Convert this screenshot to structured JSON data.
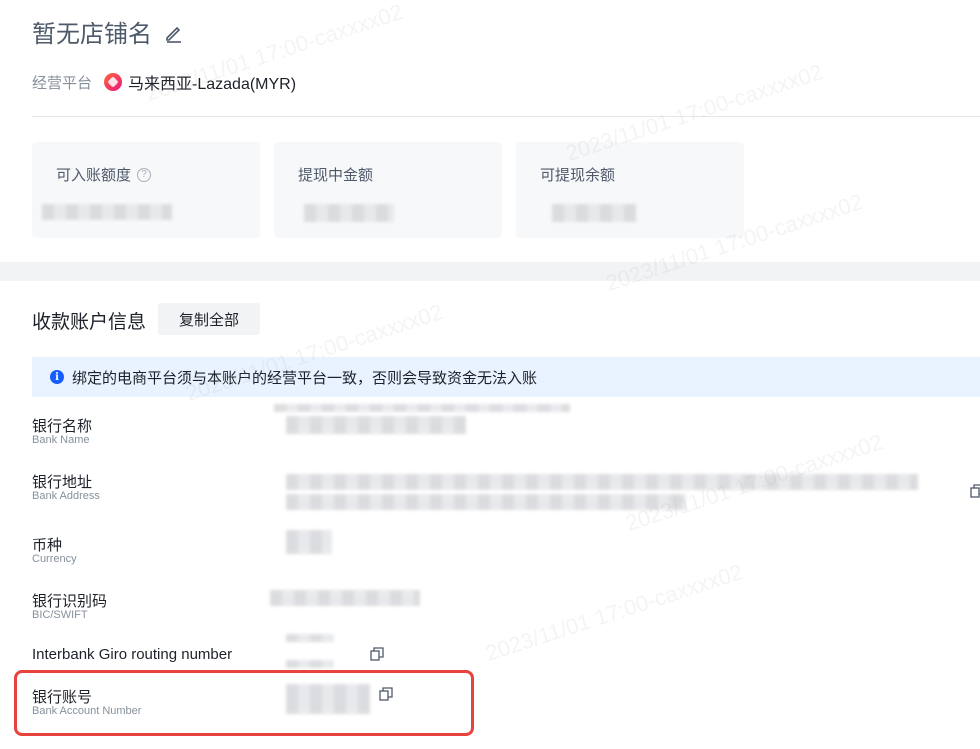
{
  "store": {
    "name": "暂无店铺名"
  },
  "platform": {
    "label": "经营平台",
    "value": "马来西亚-Lazada(MYR)"
  },
  "stats": [
    {
      "label": "可入账额度"
    },
    {
      "label": "提现中金额"
    },
    {
      "label": "可提现余额"
    }
  ],
  "account": {
    "title": "收款账户信息",
    "copy_all": "复制全部",
    "notice": "绑定的电商平台须与本账户的经营平台一致，否则会导致资金无法入账",
    "fields": [
      {
        "label": "银行名称",
        "sub": "Bank Name"
      },
      {
        "label": "银行地址",
        "sub": "Bank Address"
      },
      {
        "label": "币种",
        "sub": "Currency"
      },
      {
        "label": "银行识别码",
        "sub": "BIC/SWIFT"
      },
      {
        "label": "Interbank Giro routing number",
        "sub": ""
      },
      {
        "label": "银行账号",
        "sub": "Bank Account Number"
      }
    ]
  },
  "watermark": "2023/11/01 17:00-caxxxx02",
  "colors": {
    "highlight": "#e8423d",
    "notice_bg": "#e8f3ff",
    "info": "#165dff"
  }
}
